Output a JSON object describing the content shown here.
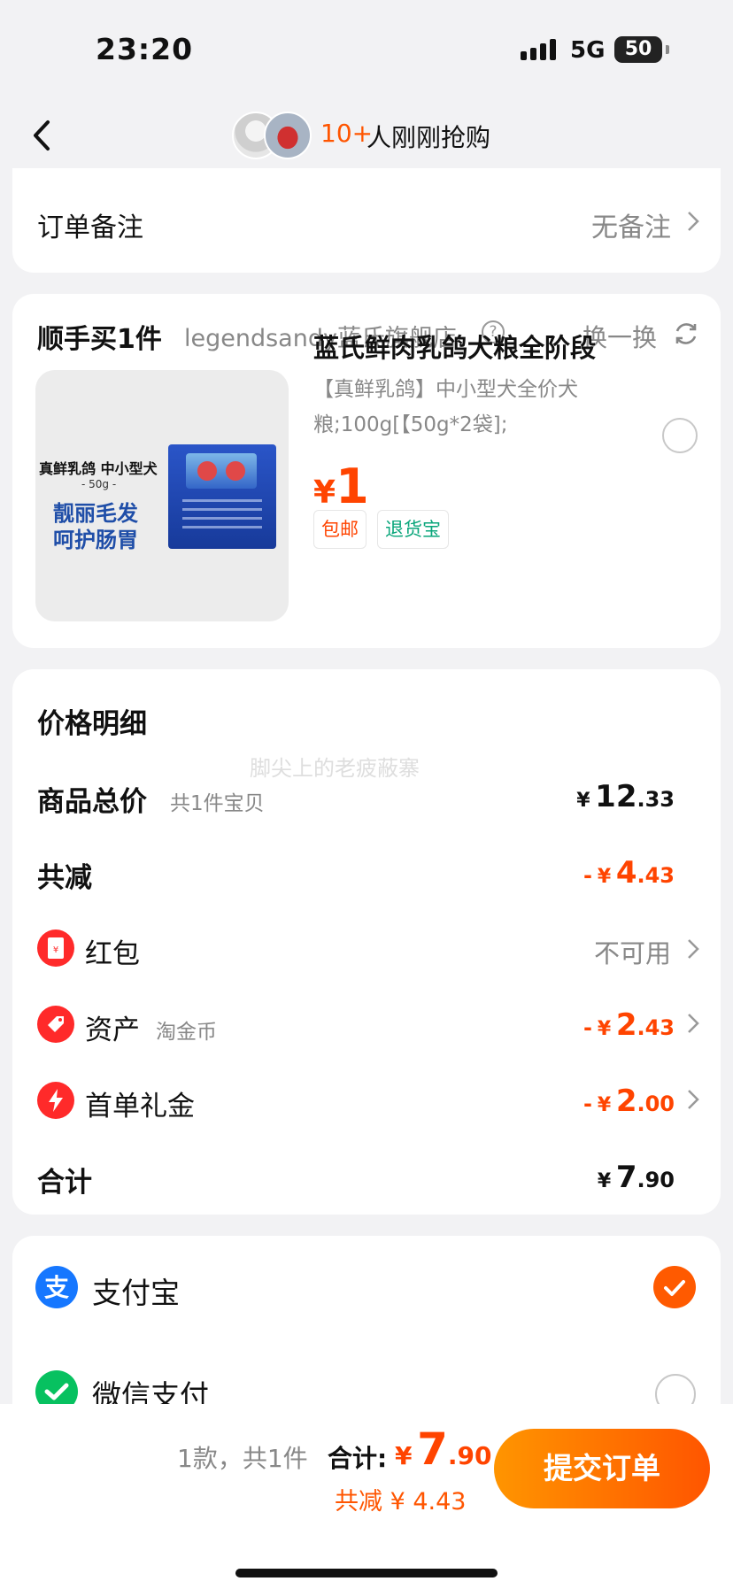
{
  "status_bar": {
    "time": "23:20",
    "network": "5G",
    "battery": "50"
  },
  "nav": {
    "count": "10+",
    "text": "人刚刚抢购"
  },
  "order_note": {
    "label": "订单备注",
    "value": "无备注"
  },
  "add_on": {
    "title": "顺手买1件",
    "store": "legendsandy蓝氏旗舰店",
    "swap_label": "换一换",
    "product": {
      "image_text_line1": "真鲜乳鸽 中小型犬",
      "image_text_line2": "- 50g -",
      "image_slogan1": "靓丽毛发",
      "image_slogan2": "呵护肠胃",
      "name": "蓝氏鲜肉乳鸽犬粮全阶段",
      "spec": "【真鲜乳鸽】中小型犬全价犬粮;100g[【50g*2袋];",
      "price_currency": "¥",
      "price": "1",
      "tags": [
        "包邮",
        "退货宝"
      ]
    }
  },
  "price_detail": {
    "title": "价格明细",
    "watermark": "脚尖上的老疲蔽寨",
    "goods_total": {
      "label": "商品总价",
      "sub": "共1件宝贝",
      "currency": "¥",
      "int": "12",
      "dec": ".33"
    },
    "total_reduction": {
      "label": "共减",
      "sign": "-",
      "currency": "¥",
      "int": "4",
      "dec": ".43"
    },
    "red_packet": {
      "label": "红包",
      "value": "不可用"
    },
    "assets": {
      "label": "资产",
      "sub": "淘金币",
      "sign": "-",
      "currency": "¥",
      "int": "2",
      "dec": ".43"
    },
    "first_order": {
      "label": "首单礼金",
      "sign": "-",
      "currency": "¥",
      "int": "2",
      "dec": ".00"
    },
    "total": {
      "label": "合计",
      "currency": "¥",
      "int": "7",
      "dec": ".90"
    }
  },
  "payment": {
    "methods": [
      {
        "label": "支付宝",
        "selected": true
      },
      {
        "label": "微信支付",
        "selected": false
      }
    ]
  },
  "bottom_bar": {
    "count_text": "1款，共1件",
    "sum_label": "合计:",
    "sum_currency": "¥",
    "sum_int": "7",
    "sum_dec": ".90",
    "discount_text": "共减 ¥ 4.43",
    "submit_label": "提交订单"
  },
  "colors": {
    "accent": "#ff5500",
    "price": "#ff4400",
    "green_tag": "#0aa67b",
    "alipay": "#1677ff",
    "wechat": "#07c160"
  }
}
